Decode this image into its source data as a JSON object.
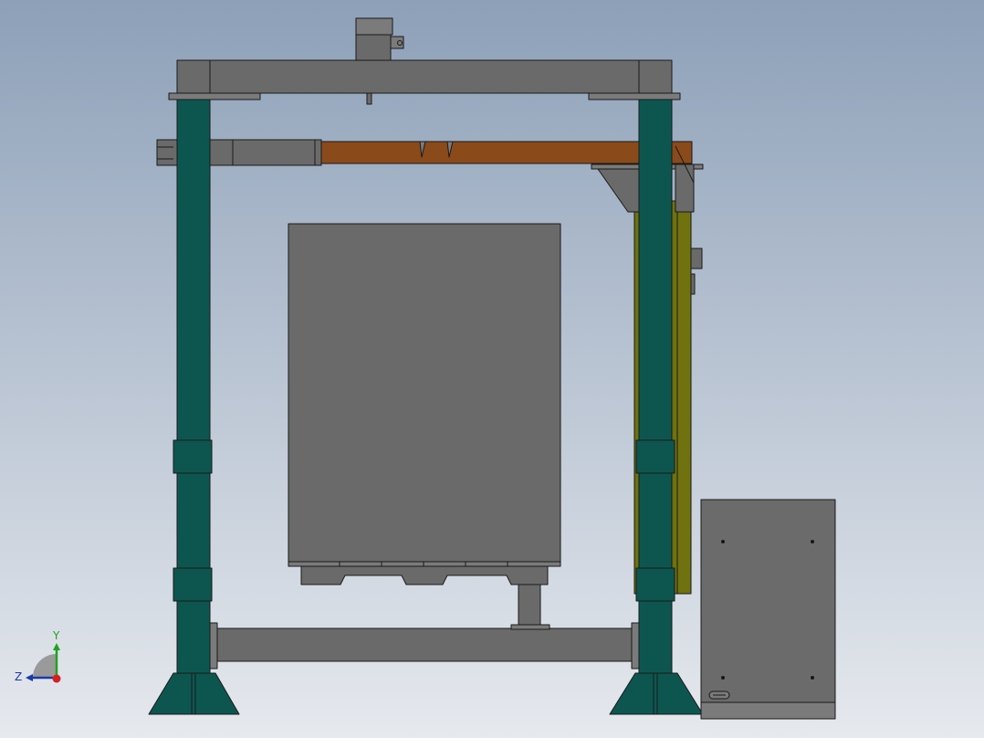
{
  "viewport": {
    "background_top": "#8da0b8",
    "background_bottom": "#e6e9ee"
  },
  "colors": {
    "column": "#0d5650",
    "steel_grey": "#6a6a6a",
    "steel_light": "#7b7b7b",
    "crossbeam_orange": "#8a4a1a",
    "olive_panel": "#6f720e",
    "cabinet": "#6b6b6b",
    "outline": "#1a1a1a"
  },
  "triad": {
    "y_label": "Y",
    "z_label": "Z",
    "y_color": "#1fa21f",
    "z_color": "#1a3aa8",
    "x_color": "#d42020"
  }
}
